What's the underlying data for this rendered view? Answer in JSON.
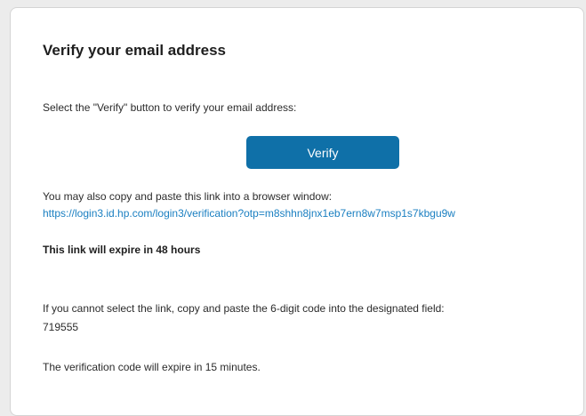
{
  "email": {
    "title": "Verify your email address",
    "instruction": "Select the \"Verify\" button to verify your email address:",
    "verify_button_label": "Verify",
    "copy_link_text": "You may also copy and paste this link into a browser window:",
    "verification_link": "https://login3.id.hp.com/login3/verification?otp=m8shhn8jnx1eb7ern8w7msp1s7kbgu9w",
    "link_expiry": "This link will expire in 48 hours",
    "code_instruction": "If you cannot select the link, copy and paste the 6-digit code into the designated field:",
    "code": "719555",
    "code_expiry": "The verification code will expire in 15 minutes."
  },
  "colors": {
    "button_bg": "#0f70a8",
    "link": "#1a7fc1"
  }
}
